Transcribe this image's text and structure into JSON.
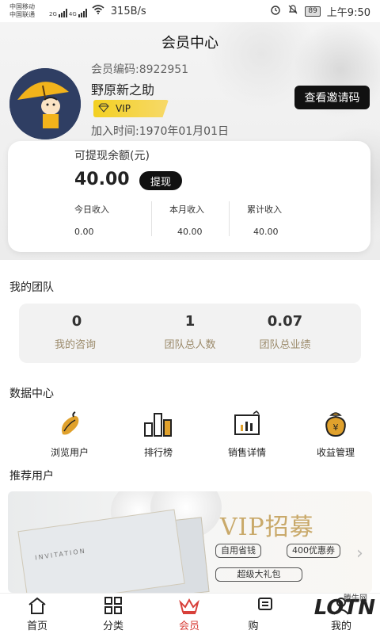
{
  "status_bar": {
    "carrier_1": "中国移动",
    "carrier_2": "中国联通",
    "net_1": "2G",
    "net_2": "4G",
    "speed": "315B/s",
    "battery": "89",
    "time": "上午9:50"
  },
  "header": {
    "title": "会员中心",
    "member_no": "会员编码:8922951",
    "username": "野原新之助",
    "vip_label": "VIP",
    "join_date": "加入时间:1970年01月01日",
    "invite_button": "查看邀请码"
  },
  "balance": {
    "label": "可提现余额(元)",
    "amount": "40.00",
    "withdraw_button": "提现",
    "stats": [
      {
        "label": "今日收入",
        "value": "0.00"
      },
      {
        "label": "本月收入",
        "value": "40.00"
      },
      {
        "label": "累计收入",
        "value": "40.00"
      }
    ]
  },
  "team": {
    "title": "我的团队",
    "items": [
      {
        "value": "0",
        "label": "我的咨询"
      },
      {
        "value": "1",
        "label": "团队总人数"
      },
      {
        "value": "0.07",
        "label": "团队总业绩"
      }
    ]
  },
  "data_center": {
    "title": "数据中心",
    "items": [
      {
        "label": "浏览用户",
        "icon": "sweet-potato-icon"
      },
      {
        "label": "排行榜",
        "icon": "bar-chart-icon"
      },
      {
        "label": "销售详情",
        "icon": "sales-chart-icon"
      },
      {
        "label": "收益管理",
        "icon": "money-bag-icon"
      }
    ]
  },
  "recommend": {
    "title": "推荐用户",
    "banner": {
      "headline": "VIP招募",
      "tag_1": "自用省钱",
      "tag_2": "400优惠券",
      "tag_3": "超级大礼包",
      "card_text": "INVITATION"
    }
  },
  "bottom_nav": {
    "items": [
      {
        "label": "首页",
        "icon": "home-icon"
      },
      {
        "label": "分类",
        "icon": "grid-icon"
      },
      {
        "label": "会员",
        "icon": "crown-icon",
        "active": true
      },
      {
        "label": "购",
        "icon": "cart-icon"
      },
      {
        "label": "我的",
        "icon": "user-icon"
      }
    ]
  },
  "watermark": {
    "text": "LOTN",
    "small": "腾牛网"
  },
  "colors": {
    "accent": "#d8403a",
    "vip_gold": "#f3d021",
    "label_gold": "#9b8a6a"
  }
}
